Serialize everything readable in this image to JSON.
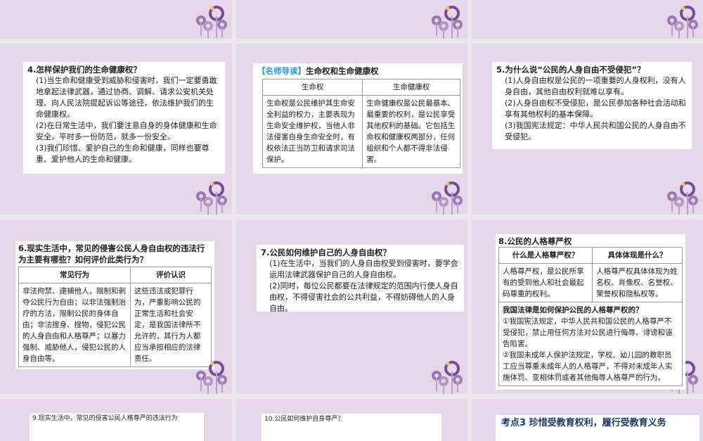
{
  "slides": [
    {
      "id": "s4",
      "title": "4.怎样保护我们的生命健康权？",
      "paras": [
        "(1)当生命和健康受到威胁和侵害时，我们一定要勇敢地拿起法律武器，通过协商、调解、请求公安机关处理、向人民法院提起诉讼等途径，依法维护我们的生命健康权。",
        "(2)在日常生活中，我们要注意自身的身体健康和生命安全，平时多一份防范，就多一份安全。",
        "(3)我们珍惜、爱护自己的生命和健康，同样也要尊重、爱护他人的生命和健康。"
      ]
    },
    {
      "id": "guide",
      "tag": "【名师导读】",
      "title": "生命权和生命健康权",
      "headers": [
        "生命权",
        "生命健康权"
      ],
      "cells": [
        "生命权是公民维护其生命安全利益的权力，主要表现为生命安全维护权，当他人非法侵害自身生命安全时，有权依法正当防卫和请求司法保护。",
        "生命健康权是公民最基本、最重要的权利，是公民享受其他权利的基础。它包括生命权和健康权两部分，任何组织和个人都不得非法侵害。"
      ]
    },
    {
      "id": "s5",
      "title": "5.为什么说“公民的人身自由不受侵犯”？",
      "paras": [
        "(1)人身自由权是公民的一项重要的人身权利，没有人身自由，其他自由权利就难以享有。",
        "(2)人身自由权不受侵犯，是公民参加各种社会活动和享有其他权利的基本保障。",
        "(3)我国宪法规定：中华人民共和国公民的人身自由不受侵犯。"
      ]
    },
    {
      "id": "s6",
      "title": "6.现实生活中，常见的侵害公民人身自由权的违法行为主要有哪些？如何评价此类行为？",
      "headers": [
        "常见行为",
        "评价认识"
      ],
      "cells": [
        "非法拘禁、逮捕他人，限制和剥夺公民行为自由；以非法强制治疗的方法，限制公民的身体自由；非法搜身、搜物，侵犯公民的人身自由和人格尊严；以暴力强制、威胁他人，侵犯公民的人身自由等。",
        "这些违法或犯罪行为，严重影响公民的正常生活和社会安定，是我国法律所不允许的，其行为人都应当承担相应的法律责任。"
      ]
    },
    {
      "id": "s7",
      "title": "7.公民如何维护自己的人身自由权？",
      "paras": [
        "(1)在生活中，当我们的人身自由权受到侵害时，要学会运用法律武器保护自己的人身自由权。",
        "(2)同时，每位公民都要在法律规定的范围内行使人身自由权，不得侵害社会的公共利益，不得妨碍他人的人身自由。"
      ]
    },
    {
      "id": "s8",
      "title": "8.公民的人格尊严权",
      "headers": [
        "什么是人格尊严权？",
        "具体体现是什么？"
      ],
      "cells": [
        "人格尊严权，是公民所享有的受到他人和社会最起码尊重的权利。",
        "人格尊严权具体体现为姓名权、肖像权、名誉权、荣誉权和隐私权等。"
      ],
      "subtitle": "我国法律是如何保护公民的人格尊严权的？",
      "paras": [
        "①我国宪法规定，中华人民共和国公民的人格尊严不受侵犯，禁止用任何方法对公民进行侮辱、诽谤和诬告陷害。",
        "②我国未成年人保护法规定，学校、幼儿园的教职员工应当尊重未成年人的人格尊严，不得对未成年人实施体罚、变相体罚或者其他侮辱人格尊严的行为。"
      ]
    },
    {
      "id": "s9",
      "title": "9.现实生活中，常见的侵害公民人格尊严的违法行为"
    },
    {
      "id": "s10",
      "title": "10.公民如何维护自身尊严？"
    },
    {
      "id": "s11",
      "title": "考点3 珍惜受教育权利，履行受教育义务"
    }
  ],
  "colors": {
    "slide_bg": "#e6d6e9",
    "accent": "#2a9ad6",
    "deco_purple": "#7a4a9a"
  }
}
